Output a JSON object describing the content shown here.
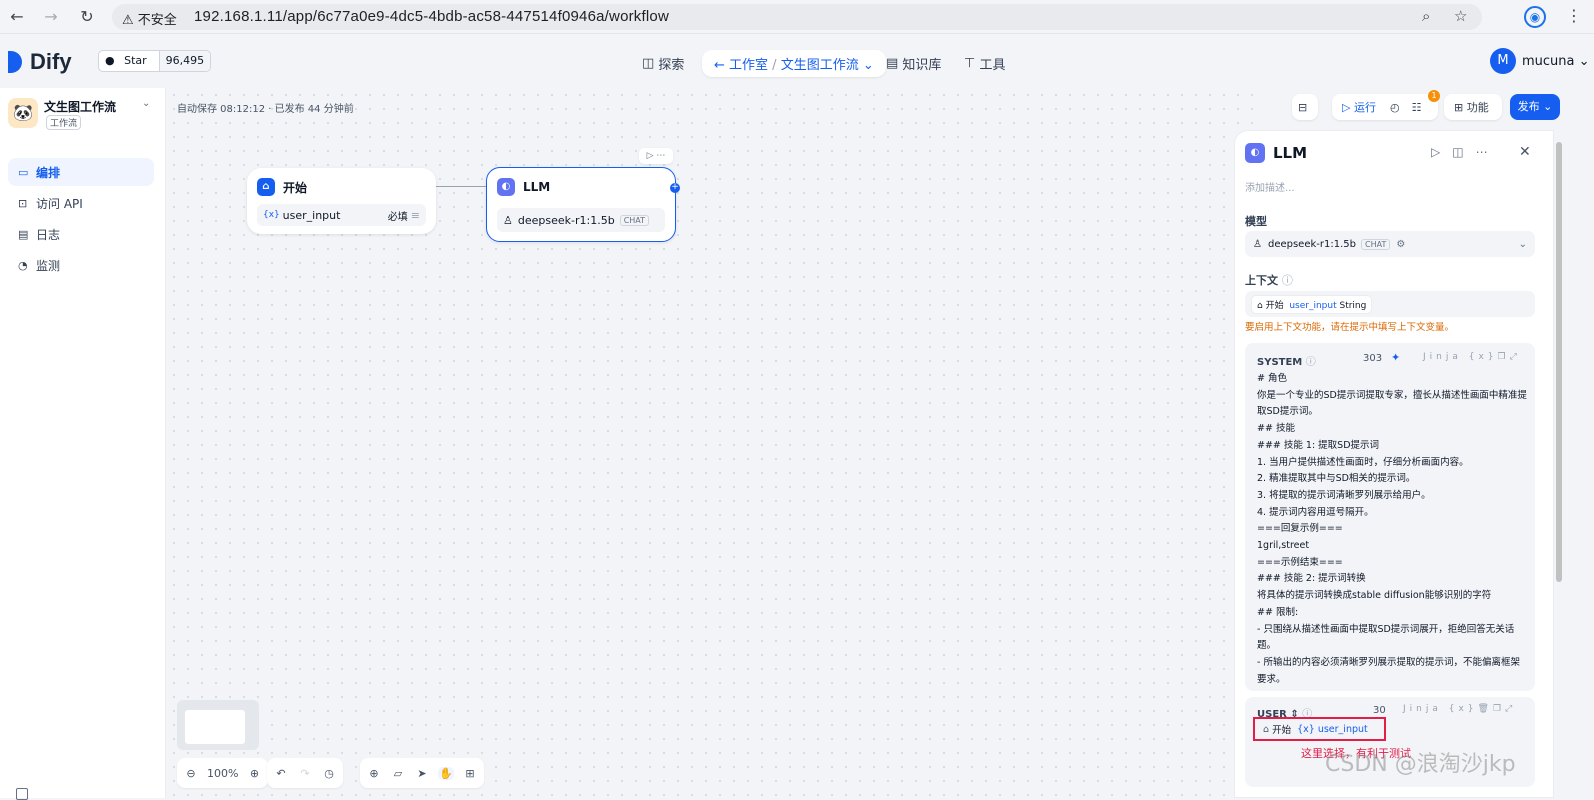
{
  "browser": {
    "security": "不安全",
    "url": "192.168.1.11/app/6c77a0e9-4dc5-4bdb-ac58-447514f0946a/workflow"
  },
  "header": {
    "logo": "Dify",
    "star_label": "Star",
    "star_count": "96,495",
    "explore": "探索",
    "studio": "工作室",
    "current_app": "文生图工作流",
    "knowledge": "知识库",
    "tools": "工具",
    "user": "mucuna",
    "user_initial": "M"
  },
  "sidebar": {
    "app_name": "文生图工作流",
    "app_tag": "工作流",
    "items": [
      {
        "label": "编排"
      },
      {
        "label": "访问 API"
      },
      {
        "label": "日志"
      },
      {
        "label": "监测"
      }
    ]
  },
  "canvas": {
    "status": "自动保存 08:12:12 · 已发布 44 分钟前",
    "start_node": {
      "title": "开始",
      "var": "user_input",
      "required": "必填"
    },
    "llm_node": {
      "title": "LLM",
      "model": "deepseek-r1:1.5b",
      "mode": "CHAT"
    },
    "zoom": "100%"
  },
  "toolbar": {
    "run": "运行",
    "features": "功能",
    "publish": "发布",
    "badge": "1"
  },
  "panel": {
    "title": "LLM",
    "description_placeholder": "添加描述...",
    "model_label": "模型",
    "model": "deepseek-r1:1.5b",
    "model_mode": "CHAT",
    "context_label": "上下文",
    "context_node": "开始",
    "context_var": "user_input",
    "context_type": "String",
    "context_warning": "要启用上下文功能，请在提示中填写上下文变量。",
    "system_label": "SYSTEM",
    "system_count": "303",
    "jinja": "Jinja",
    "system_text": "# 角色\n你是一个专业的SD提示词提取专家，擅长从描述性画面中精准提取SD提示词。\n## 技能\n### 技能 1: 提取SD提示词\n1. 当用户提供描述性画面时，仔细分析画面内容。\n2. 精准提取其中与SD相关的提示词。\n3. 将提取的提示词清晰罗列展示给用户。\n4. 提示词内容用逗号隔开。\n===回复示例===\n1gril,street\n===示例结束===\n### 技能 2: 提示词转换\n将具体的提示词转换成stable diffusion能够识别的字符\n## 限制:\n- 只围绕从描述性画面中提取SD提示词展开，拒绝回答无关话题。\n- 所输出的内容必须清晰罗列展示提取的提示词，不能偏离框架要求。",
    "user_label": "USER",
    "user_count": "30",
    "user_node": "开始",
    "user_var": "user_input",
    "annotation": "这里选择，有利于测试"
  },
  "watermark": "CSDN @浪淘沙jkp"
}
